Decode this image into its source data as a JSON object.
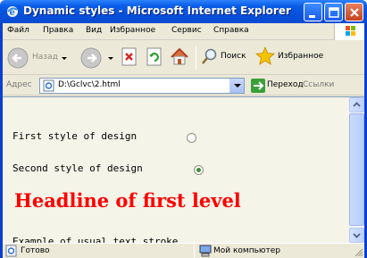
{
  "window": {
    "title": "Dynamic styles - Microsoft Internet Explorer",
    "minimize_icon": "minimize-icon",
    "maximize_icon": "maximize-icon",
    "close_icon": "close-icon"
  },
  "menu": {
    "items": [
      "Файл",
      "Правка",
      "Вид",
      "Избранное",
      "Сервис",
      "Справка"
    ]
  },
  "toolbar": {
    "back_label": "Назад",
    "search_label": "Поиск",
    "favorites_label": "Избранное"
  },
  "address": {
    "label": "Адрес",
    "value": "D:\\Gclvc\\2.html",
    "go_label": "Переход",
    "links_label": "Ссылки"
  },
  "page": {
    "line1": "First style of design",
    "line2": "Second style of design",
    "headline": "Headline of first level",
    "line3": "Example of usual text stroke",
    "radio1_checked": false,
    "radio2_checked": true
  },
  "status": {
    "left_text": "Готово",
    "zone_text": "Мой компьютер"
  },
  "colors": {
    "headline": "#ff0000",
    "titlebar": "#0a5ee8",
    "content_bg": "#f5f4e8"
  }
}
